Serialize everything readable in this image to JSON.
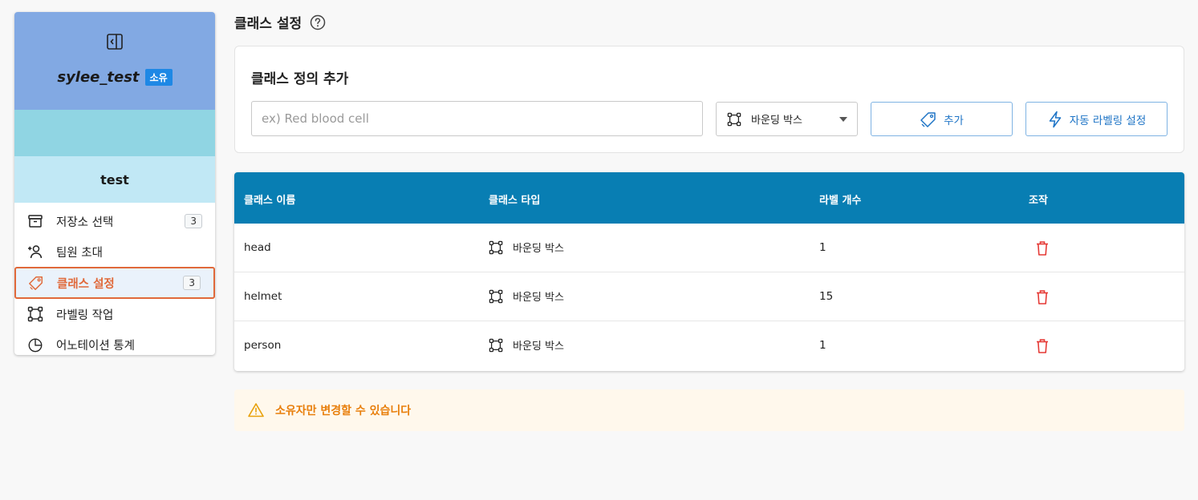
{
  "sidebar": {
    "workspace_name": "sylee_test",
    "owner_badge": "소유",
    "project_name": "test",
    "items": [
      {
        "label": "저장소 선택",
        "count": "3",
        "icon": "archive-icon"
      },
      {
        "label": "팀원 초대",
        "icon": "user-plus-icon"
      },
      {
        "label": "클래스 설정",
        "count": "3",
        "icon": "tag-icon",
        "active": true
      },
      {
        "label": "라벨링 작업",
        "icon": "bounding-box-icon"
      },
      {
        "label": "어노테이션 통계",
        "icon": "pie-chart-icon"
      }
    ],
    "active_color": "#e0693a"
  },
  "page": {
    "title": "클래스 설정"
  },
  "add_card": {
    "title": "클래스 정의 추가",
    "input_placeholder": "ex) Red blood cell",
    "input_value": "",
    "type_selected": "바운딩 박스",
    "add_button": "추가",
    "auto_label_button": "자동 라벨링 설정"
  },
  "table": {
    "headers": [
      "클래스 이름",
      "클래스 타입",
      "라벨 개수",
      "조작"
    ],
    "header_color": "#087eb3",
    "rows": [
      {
        "name": "head",
        "type": "바운딩 박스",
        "count": "1"
      },
      {
        "name": "helmet",
        "type": "바운딩 박스",
        "count": "15"
      },
      {
        "name": "person",
        "type": "바운딩 박스",
        "count": "1"
      }
    ]
  },
  "notice": {
    "text": "소유자만 변경할 수 있습니다",
    "color": "#e87f0c"
  }
}
